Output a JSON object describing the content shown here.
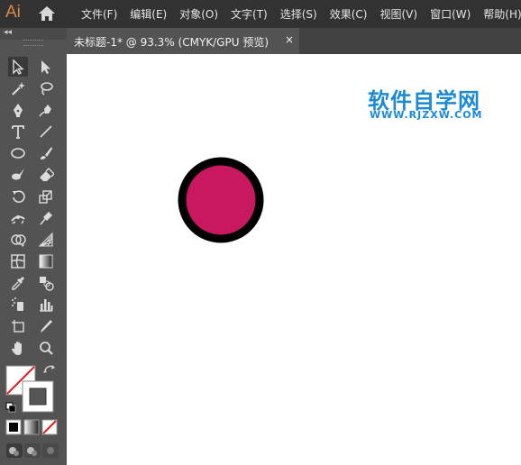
{
  "app": {
    "logo": "Ai"
  },
  "menu": [
    "文件(F)",
    "编辑(E)",
    "对象(O)",
    "文字(T)",
    "选择(S)",
    "效果(C)",
    "视图(V)",
    "窗口(W)",
    "帮助(H)"
  ],
  "document_tab": {
    "title": "未标题-1* @ 93.3% (CMYK/GPU 预览)",
    "close": "×"
  },
  "toolbar_header": "◂◂",
  "tools": [
    "selection-tool-icon",
    "direct-selection-tool-icon",
    "magic-wand-tool-icon",
    "lasso-tool-icon",
    "pen-tool-icon",
    "curvature-tool-icon",
    "type-tool-icon",
    "line-segment-tool-icon",
    "ellipse-tool-icon",
    "paintbrush-tool-icon",
    "blob-brush-tool-icon",
    "eraser-tool-icon",
    "rotate-tool-icon",
    "scale-tool-icon",
    "width-tool-icon",
    "puppet-warp-tool-icon",
    "shape-builder-tool-icon",
    "perspective-grid-tool-icon",
    "mesh-tool-icon",
    "gradient-tool-icon",
    "eyedropper-tool-icon",
    "blend-tool-icon",
    "symbol-sprayer-tool-icon",
    "column-graph-tool-icon",
    "artboard-tool-icon",
    "slice-tool-icon",
    "hand-tool-icon",
    "zoom-tool-icon"
  ],
  "watermark": {
    "title": "软件自学网",
    "url": "WWW.RJZXW.COM"
  },
  "colors": {
    "circle_fill": "#c8185f",
    "circle_stroke": "#000000",
    "watermark": "#1a8ad4",
    "logo": "#d98b4a"
  }
}
